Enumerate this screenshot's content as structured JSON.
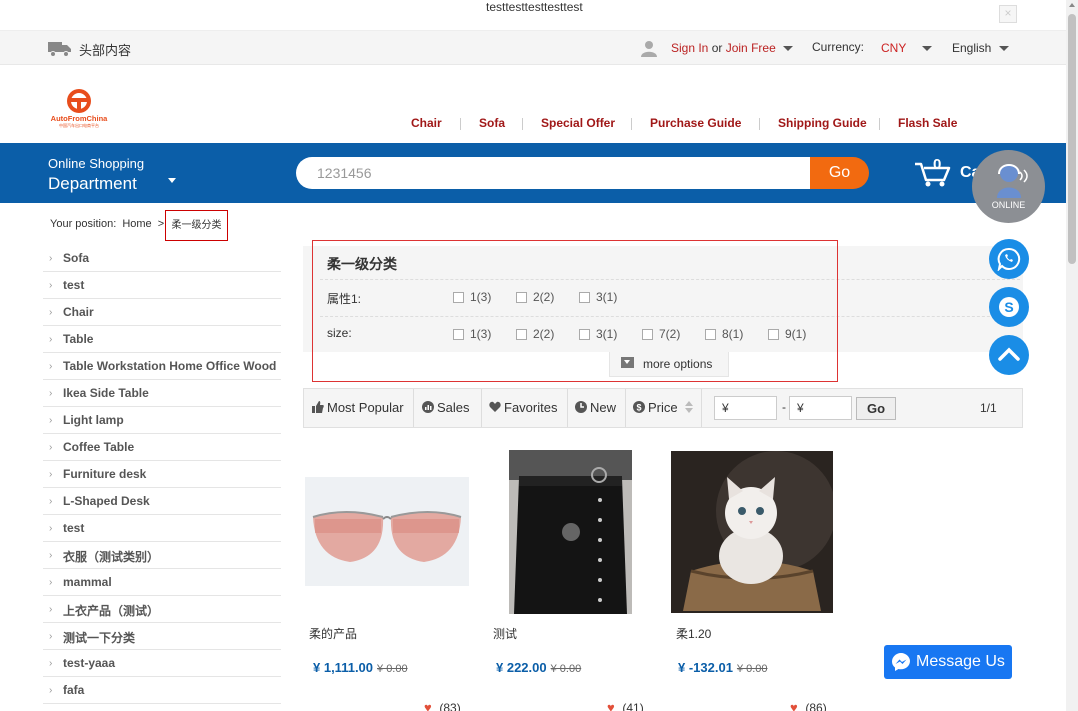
{
  "notice": {
    "text": "testtesttesttesttest",
    "close": "×"
  },
  "topbar": {
    "head_text": "头部内容",
    "sign_in": "Sign In",
    "or": "or",
    "join": "Join Free",
    "currency_label": "Currency:",
    "currency_value": "CNY",
    "language": "English"
  },
  "logo": {
    "name": "AutoFromChina",
    "sub": "中国汽车出口电商平台"
  },
  "nav": [
    "Chair",
    "Sofa",
    "Special Offer",
    "Purchase Guide",
    "Shipping Guide",
    "Flash Sale"
  ],
  "dept": {
    "small": "Online Shopping",
    "big": "Department"
  },
  "search": {
    "value": "1231456",
    "go": "Go"
  },
  "cart": {
    "count": "0",
    "label": "Cart"
  },
  "breadcrumb": {
    "label": "Your position:",
    "home": "Home",
    "sep": ">",
    "current": "柔一级分类"
  },
  "categories": [
    "Sofa",
    "test",
    "Chair",
    "Table",
    "Table Workstation Home Office Wood",
    "Ikea Side Table",
    "Light lamp",
    "Coffee Table",
    "Furniture desk",
    "L-Shaped Desk",
    "test",
    "衣服（测试类别）",
    "mammal",
    "上衣产品（测试）",
    "测试一下分类",
    "test-yaaa",
    "fafa"
  ],
  "filter": {
    "title": "柔一级分类",
    "rows": [
      {
        "label": "属性1:",
        "options": [
          "1(3)",
          "2(2)",
          "3(1)"
        ]
      },
      {
        "label": "size:",
        "options": [
          "1(3)",
          "2(2)",
          "3(1)",
          "7(2)",
          "8(1)",
          "9(1)"
        ]
      }
    ],
    "more": "more options"
  },
  "sort": {
    "items": [
      "Most Popular",
      "Sales",
      "Favorites",
      "New",
      "Price"
    ],
    "price_from": "¥",
    "price_to": "¥",
    "dash": "-",
    "go": "Go",
    "page": "1/1"
  },
  "products": [
    {
      "name": "柔的产品",
      "price": "¥ 1,111.00",
      "old": "¥ 0.00",
      "likes": "(83)"
    },
    {
      "name": "测试",
      "price": "¥ 222.00",
      "old": "¥ 0.00",
      "likes": "(41)"
    },
    {
      "name": "柔1.20",
      "price": "¥ -132.01",
      "old": "¥ 0.00",
      "likes": "(86)"
    }
  ],
  "float": {
    "online": "ONLINE",
    "message_us": "Message Us"
  },
  "colors": {
    "brand_blue": "#0b5ea8",
    "accent_orange": "#f26a10",
    "nav_red": "#a01818"
  }
}
